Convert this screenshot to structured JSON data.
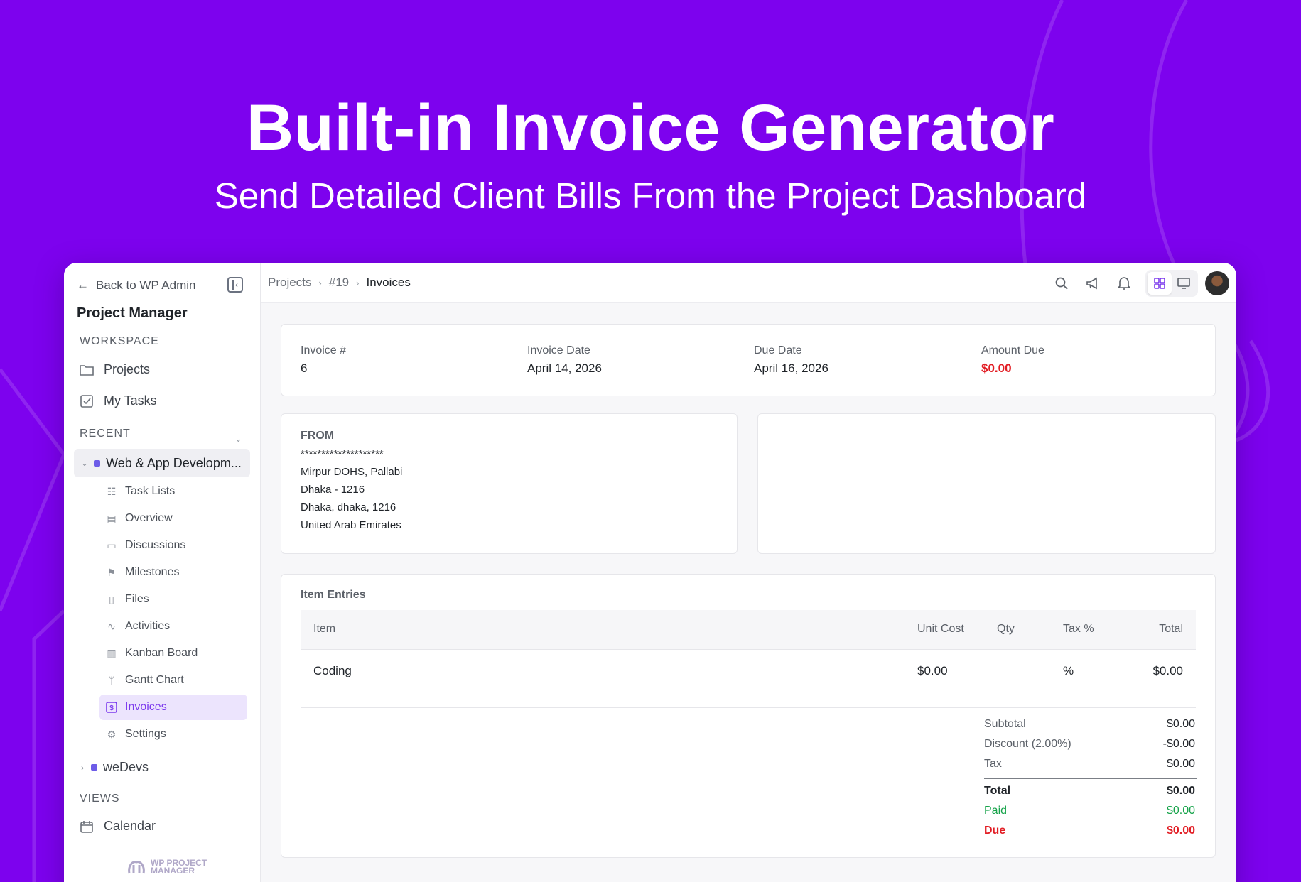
{
  "hero": {
    "title": "Built-in Invoice Generator",
    "subtitle": "Send Detailed Client Bills From the Project Dashboard"
  },
  "sidebar": {
    "back_label": "Back to WP Admin",
    "app_name": "Project Manager",
    "workspace_label": "WORKSPACE",
    "workspace_items": [
      {
        "label": "Projects",
        "icon": "folder-icon"
      },
      {
        "label": "My Tasks",
        "icon": "checkbox-icon"
      }
    ],
    "recent_label": "RECENT",
    "recent_project": "Web & App Developm...",
    "project_items": [
      {
        "label": "Task Lists",
        "icon": "list-icon"
      },
      {
        "label": "Overview",
        "icon": "layout-icon"
      },
      {
        "label": "Discussions",
        "icon": "chat-icon"
      },
      {
        "label": "Milestones",
        "icon": "signpost-icon"
      },
      {
        "label": "Files",
        "icon": "file-icon"
      },
      {
        "label": "Activities",
        "icon": "activity-icon"
      },
      {
        "label": "Kanban Board",
        "icon": "kanban-icon"
      },
      {
        "label": "Gantt Chart",
        "icon": "branch-icon"
      },
      {
        "label": "Invoices",
        "icon": "invoice-icon",
        "active": true
      },
      {
        "label": "Settings",
        "icon": "gear-icon"
      }
    ],
    "other_project": "weDevs",
    "views_label": "VIEWS",
    "views_items": [
      {
        "label": "Calendar",
        "icon": "calendar-icon"
      }
    ],
    "logo_text_1": "WP PROJECT",
    "logo_text_2": "MANAGER"
  },
  "breadcrumb": {
    "items": [
      "Projects",
      "#19",
      "Invoices"
    ]
  },
  "invoice": {
    "number_label": "Invoice #",
    "number": "6",
    "date_label": "Invoice Date",
    "date": "April 14, 2026",
    "due_label": "Due Date",
    "due": "April 16, 2026",
    "amount_label": "Amount Due",
    "amount": "$0.00"
  },
  "from": {
    "heading": "FROM",
    "lines": [
      "********************",
      "Mirpur DOHS, Pallabi",
      "Dhaka - 1216",
      "Dhaka, dhaka, 1216",
      "United Arab Emirates"
    ]
  },
  "items": {
    "heading": "Item Entries",
    "columns": [
      "Item",
      "Unit Cost",
      "Qty",
      "Tax %",
      "Total"
    ],
    "rows": [
      {
        "item": "Coding",
        "unit_cost": "$0.00",
        "qty": "",
        "tax": "%",
        "total": "$0.00"
      }
    ]
  },
  "summary": {
    "subtotal_label": "Subtotal",
    "subtotal": "$0.00",
    "discount_label": "Discount (2.00%)",
    "discount": "-$0.00",
    "tax_label": "Tax",
    "tax": "$0.00",
    "total_label": "Total",
    "total": "$0.00",
    "paid_label": "Paid",
    "paid": "$0.00",
    "due_label": "Due",
    "due": "$0.00"
  },
  "colors": {
    "background": "#7d02ee",
    "accent": "#7c3aed",
    "due_red": "#e21d24",
    "paid_green": "#16a34a"
  }
}
